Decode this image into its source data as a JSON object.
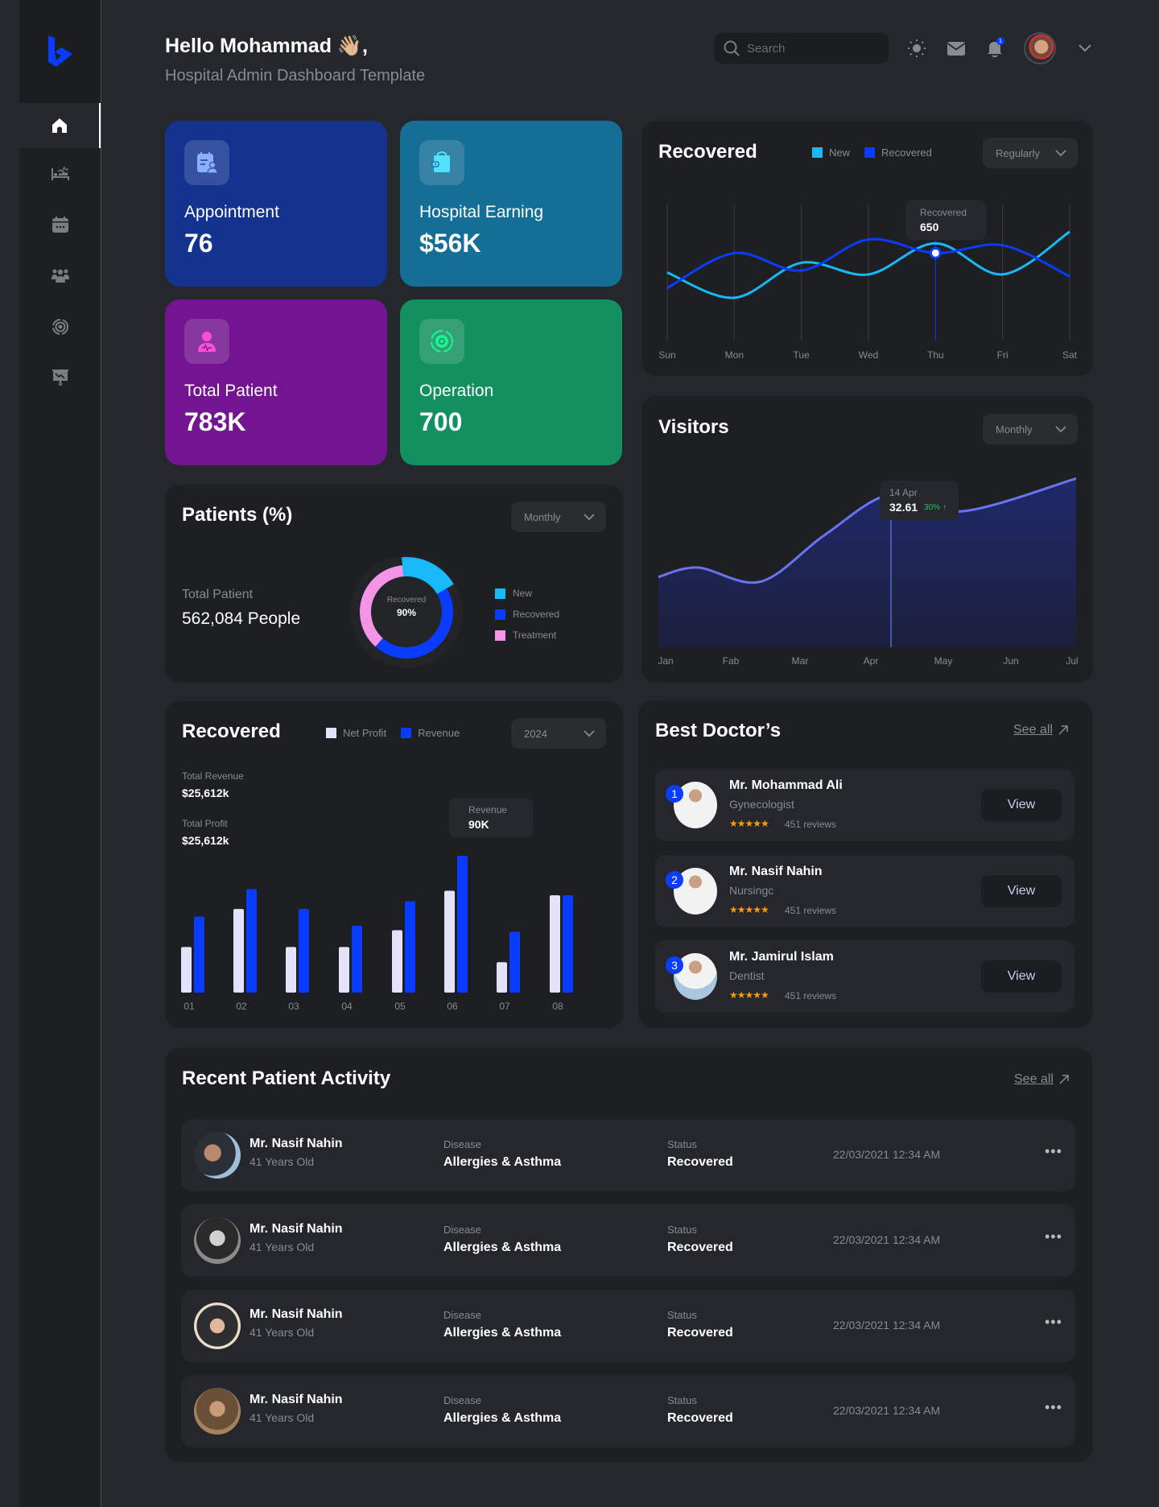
{
  "header": {
    "greeting": "Hello Mohammad 👋🏼,",
    "subtitle": "Hospital Admin Dashboard Template",
    "search_placeholder": "Search",
    "notification_count": "1"
  },
  "sidebar": {
    "items": [
      {
        "name": "home",
        "active": true
      },
      {
        "name": "beds"
      },
      {
        "name": "calendar"
      },
      {
        "name": "patients"
      },
      {
        "name": "operations"
      },
      {
        "name": "reports"
      }
    ]
  },
  "colors": {
    "accent": "#0a3cff",
    "new": "#17b9f8",
    "treatment": "#f593e6",
    "net_profit": "#e4e1fb",
    "visitors_line": "#6a74f3",
    "growth": "#22c55e",
    "star": "#f59e0b"
  },
  "stats": [
    {
      "label": "Appointment",
      "value": "76",
      "bg": "#13338f",
      "icon": "appointment-icon"
    },
    {
      "label": "Hospital Earning",
      "value": "$56K",
      "bg": "#156e96",
      "icon": "wallet-icon"
    },
    {
      "label": "Total Patient",
      "value": "783K",
      "bg": "#731590",
      "icon": "patient-icon"
    },
    {
      "label": "Operation",
      "value": "700",
      "bg": "#12905f",
      "icon": "operation-gear-icon"
    }
  ],
  "recovered_line": {
    "title": "Recovered",
    "legend": [
      "New",
      "Recovered"
    ],
    "dropdown": "Regularly",
    "tooltip_label": "Recovered",
    "tooltip_value": "650"
  },
  "visitors": {
    "title": "Visitors",
    "dropdown": "Monthly",
    "tooltip_date": "14 Apr",
    "tooltip_value": "32.61",
    "tooltip_change": "30% ↑"
  },
  "patients": {
    "title": "Patients (%)",
    "dropdown": "Monthly",
    "total_label": "Total Patient",
    "total_value": "562,084 People",
    "center_label": "Recovered",
    "center_value": "90%",
    "legend": [
      "New",
      "Recovered",
      "Treatment"
    ]
  },
  "bar_panel": {
    "title": "Recovered",
    "legend": [
      "Net Profit",
      "Revenue"
    ],
    "dropdown": "2024",
    "total_revenue_label": "Total Revenue",
    "total_revenue_value": "$25,612k",
    "total_profit_label": "Total Profit",
    "total_profit_value": "$25,612k",
    "tooltip_label": "Revenue",
    "tooltip_value": "90K"
  },
  "doctors": {
    "title": "Best Doctor’s",
    "see_all": "See all",
    "list": [
      {
        "rank": "1",
        "name": "Mr. Mohammad Ali",
        "specialty": "Gynecologist",
        "stars": "★★★★★",
        "rating": 5,
        "reviews": "451 reviews",
        "action": "View"
      },
      {
        "rank": "2",
        "name": "Mr. Nasif Nahin",
        "specialty": "Nursingc",
        "stars": "★★★★★",
        "rating": 5,
        "reviews": "451 reviews",
        "action": "View"
      },
      {
        "rank": "3",
        "name": "Mr. Jamirul Islam",
        "specialty": "Dentist",
        "stars": "★★★★★",
        "rating": 5,
        "reviews": "451 reviews",
        "action": "View"
      }
    ]
  },
  "activity": {
    "title": "Recent Patient Activity",
    "see_all": "See all",
    "rows": [
      {
        "name": "Mr. Nasif Nahin",
        "age": "41 Years Old",
        "disease_label": "Disease",
        "disease": "Allergies & Asthma",
        "status_label": "Status",
        "status": "Recovered",
        "date": "22/03/2021 12:34 AM"
      },
      {
        "name": "Mr. Nasif Nahin",
        "age": "41 Years Old",
        "disease_label": "Disease",
        "disease": "Allergies & Asthma",
        "status_label": "Status",
        "status": "Recovered",
        "date": "22/03/2021 12:34 AM"
      },
      {
        "name": "Mr. Nasif Nahin",
        "age": "41 Years Old",
        "disease_label": "Disease",
        "disease": "Allergies & Asthma",
        "status_label": "Status",
        "status": "Recovered",
        "date": "22/03/2021 12:34 AM"
      },
      {
        "name": "Mr. Nasif Nahin",
        "age": "41 Years Old",
        "disease_label": "Disease",
        "disease": "Allergies & Asthma",
        "status_label": "Status",
        "status": "Recovered",
        "date": "22/03/2021 12:34 AM"
      }
    ]
  },
  "chart_data": [
    {
      "type": "line",
      "title": "Recovered",
      "categories": [
        "Sun",
        "Mon",
        "Tue",
        "Wed",
        "Thu",
        "Fri",
        "Sat"
      ],
      "series": [
        {
          "name": "New",
          "values": [
            550,
            420,
            600,
            540,
            700,
            540,
            760
          ]
        },
        {
          "name": "Recovered",
          "values": [
            470,
            650,
            560,
            720,
            650,
            690,
            530
          ]
        }
      ],
      "highlight": {
        "series": "Recovered",
        "category": "Thu",
        "value": 650
      },
      "ylim": [
        200,
        900
      ],
      "grid": "vertical"
    },
    {
      "type": "area",
      "title": "Visitors",
      "categories": [
        "Jan",
        "Fab",
        "Mar",
        "Apr",
        "May",
        "Jun",
        "Jul"
      ],
      "values": [
        15,
        17,
        14,
        24,
        32.61,
        29,
        36
      ],
      "highlight": {
        "label": "14 Apr",
        "value": 32.61,
        "change": "30%"
      },
      "ylim": [
        0,
        45
      ]
    },
    {
      "type": "pie",
      "title": "Patients (%)",
      "labels": [
        "New",
        "Recovered",
        "Treatment"
      ],
      "values": [
        18,
        45,
        37
      ],
      "center_text": "Recovered 90%"
    },
    {
      "type": "bar",
      "title": "Recovered",
      "categories": [
        "01",
        "02",
        "03",
        "04",
        "05",
        "06",
        "07",
        "08"
      ],
      "series": [
        {
          "name": "Net Profit",
          "values": [
            30,
            55,
            30,
            30,
            41,
            67,
            20,
            64
          ]
        },
        {
          "name": "Revenue",
          "values": [
            50,
            68,
            55,
            44,
            60,
            90,
            40,
            64
          ]
        }
      ],
      "highlight": {
        "series": "Revenue",
        "category": "06",
        "value": "90K"
      },
      "ylim": [
        0,
        90
      ]
    }
  ]
}
